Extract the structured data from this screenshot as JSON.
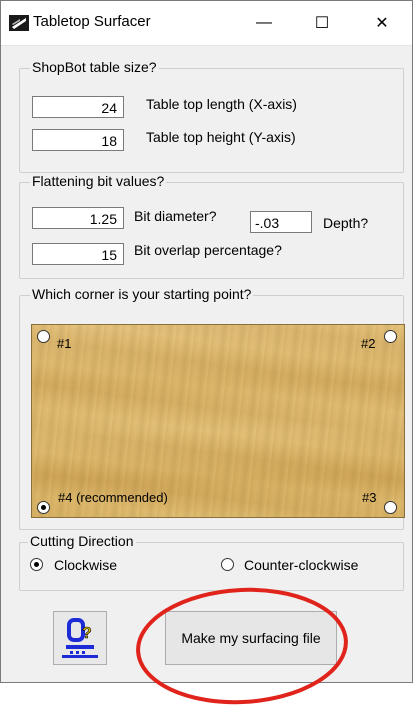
{
  "window": {
    "title": "Tabletop Surfacer",
    "minimize": "—",
    "maximize": "☐",
    "close": "✕"
  },
  "table_size": {
    "legend": "ShopBot table size?",
    "length_value": "24",
    "length_label": "Table top length (X-axis)",
    "height_value": "18",
    "height_label": "Table top height (Y-axis)"
  },
  "bit": {
    "legend": "Flattening bit values?",
    "diameter_value": "1.25",
    "diameter_label": "Bit diameter?",
    "depth_value": "-.03",
    "depth_label": "Depth?",
    "overlap_value": "15",
    "overlap_label": "Bit overlap percentage?"
  },
  "corner": {
    "legend": "Which corner is your starting point?",
    "c1": "#1",
    "c2": "#2",
    "c3": "#3",
    "c4": "#4 (recommended)",
    "selected": "#4"
  },
  "direction": {
    "legend": "Cutting Direction",
    "clockwise": "Clockwise",
    "counter": "Counter-clockwise",
    "selected": "Clockwise"
  },
  "buttons": {
    "make_file": "Make my surfacing file"
  },
  "colors": {
    "annotation_circle": "#e0231b",
    "wood": "#dcb86c",
    "window_bg": "#f0f0f0"
  }
}
